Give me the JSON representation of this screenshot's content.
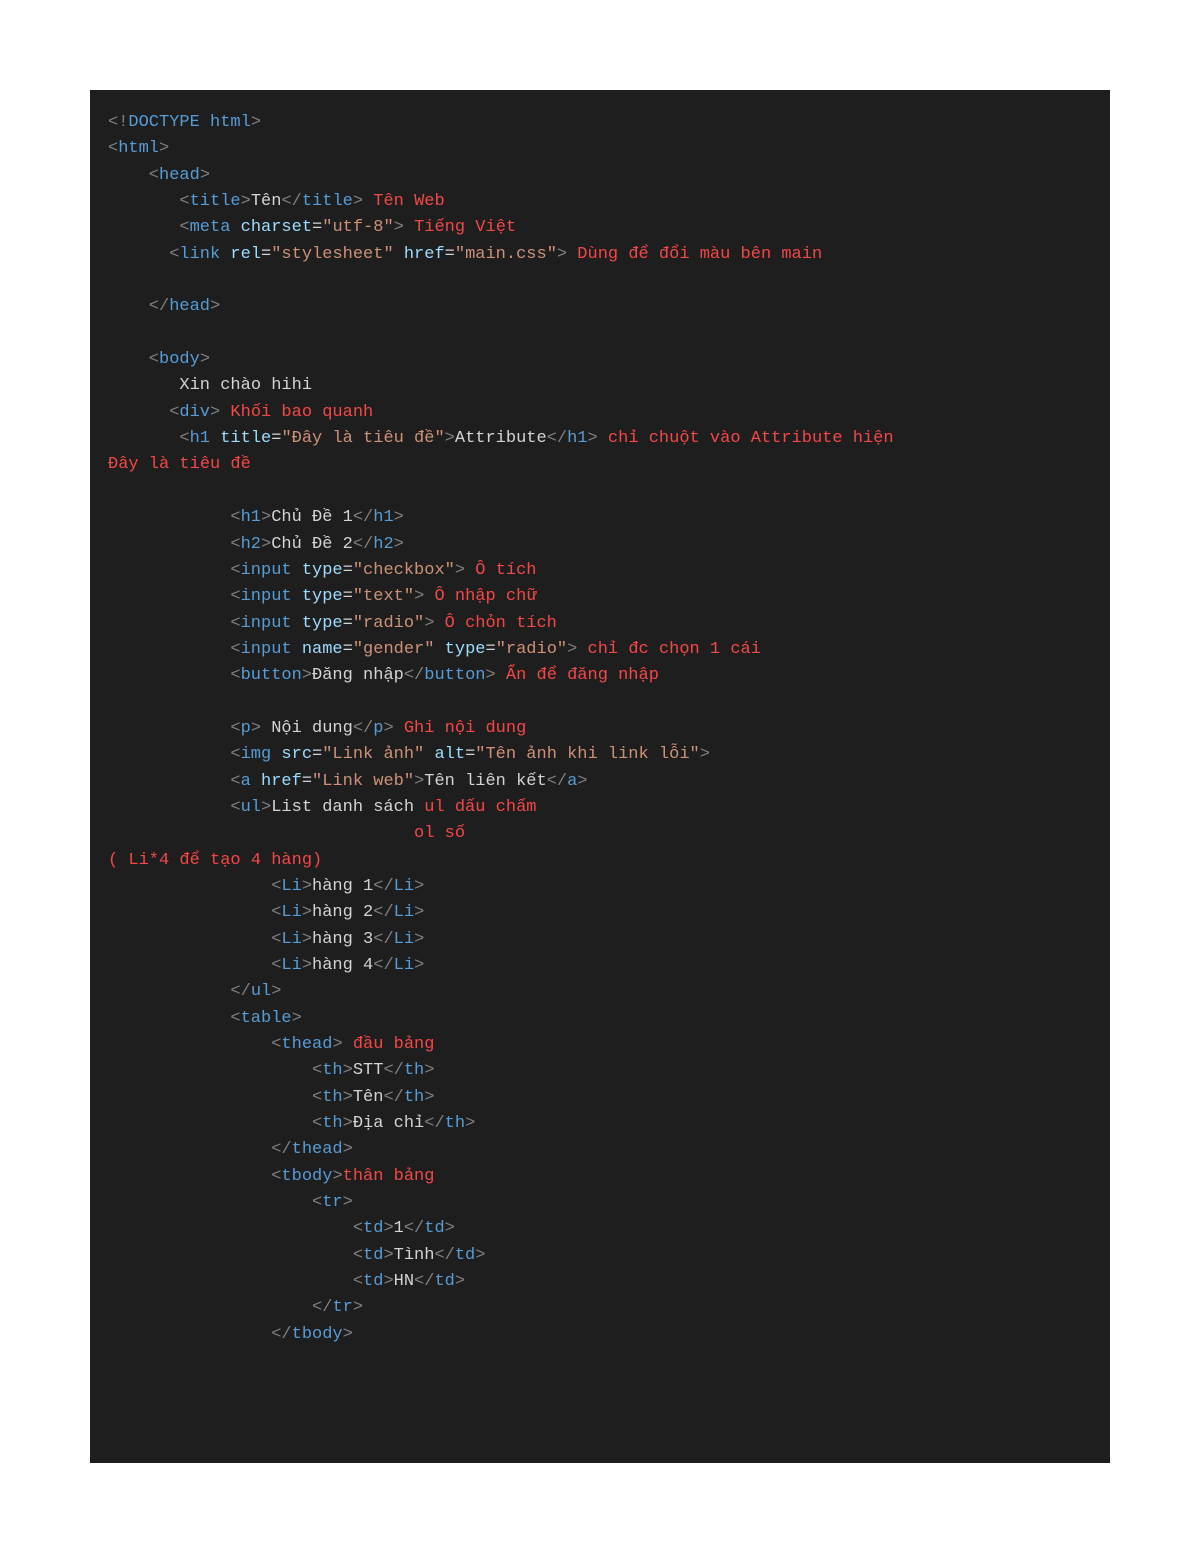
{
  "code": {
    "l1": {
      "p1": "<!",
      "p2": "DOCTYPE",
      "p3": " ",
      "p4": "html",
      "p5": ">"
    },
    "l2": {
      "p1": "<",
      "p2": "html",
      "p3": ">"
    },
    "l3": {
      "p1": "<",
      "p2": "head",
      "p3": ">"
    },
    "l4": {
      "p1": "<",
      "p2": "title",
      "p3": ">",
      "p4": "Tên",
      "p5": "</",
      "p6": "title",
      "p7": ">",
      "p8": " Tên Web"
    },
    "l5": {
      "p1": "<",
      "p2": "meta",
      "p3": " ",
      "p4": "charset",
      "p5": "=",
      "p6": "\"utf-8\"",
      "p7": ">",
      "p8": " Tiếng Việt"
    },
    "l6": {
      "p1": "<",
      "p2": "link",
      "p3": " ",
      "p4": "rel",
      "p5": "=",
      "p6": "\"stylesheet\"",
      "p7": " ",
      "p8": "href",
      "p9": "=",
      "p10": "\"main.css\"",
      "p11": ">",
      "p12": " Dùng để đổi màu bên main"
    },
    "l7": {
      "p1": "</",
      "p2": "head",
      "p3": ">"
    },
    "l8": {
      "p1": "<",
      "p2": "body",
      "p3": ">"
    },
    "l9": {
      "p1": "Xin chào hihi"
    },
    "l10": {
      "p1": "<",
      "p2": "div",
      "p3": ">",
      "p4": " Khối bao quanh"
    },
    "l11": {
      "p1": "<",
      "p2": "h1",
      "p3": " ",
      "p4": "title",
      "p5": "=",
      "p6": "\"Đây là tiêu đề\"",
      "p7": ">",
      "p8": "Attribute",
      "p9": "</",
      "p10": "h1",
      "p11": ">",
      "p12": " chỉ chuột vào Attribute hiện"
    },
    "l12": {
      "p1": "Đây là tiêu đề"
    },
    "l13": {
      "p1": "<",
      "p2": "h1",
      "p3": ">",
      "p4": "Chủ Đề 1",
      "p5": "</",
      "p6": "h1",
      "p7": ">"
    },
    "l14": {
      "p1": "<",
      "p2": "h2",
      "p3": ">",
      "p4": "Chủ Đề 2",
      "p5": "</",
      "p6": "h2",
      "p7": ">"
    },
    "l15": {
      "p1": "<",
      "p2": "input",
      "p3": " ",
      "p4": "type",
      "p5": "=",
      "p6": "\"checkbox\"",
      "p7": ">",
      "p8": " Ô tích"
    },
    "l16": {
      "p1": "<",
      "p2": "input",
      "p3": " ",
      "p4": "type",
      "p5": "=",
      "p6": "\"text\"",
      "p7": ">",
      "p8": " Ô nhập chữ"
    },
    "l17": {
      "p1": "<",
      "p2": "input",
      "p3": " ",
      "p4": "type",
      "p5": "=",
      "p6": "\"radio\"",
      "p7": ">",
      "p8": " Ô chỏn tích"
    },
    "l18": {
      "p1": "<",
      "p2": "input",
      "p3": " ",
      "p4": "name",
      "p5": "=",
      "p6": "\"gender\"",
      "p7": " ",
      "p8": "type",
      "p9": "=",
      "p10": "\"radio\"",
      "p11": ">",
      "p12": " chỉ đc chọn 1 cái"
    },
    "l19": {
      "p1": "<",
      "p2": "button",
      "p3": ">",
      "p4": "Đăng nhập",
      "p5": "</",
      "p6": "button",
      "p7": ">",
      "p8": " Ẩn để đăng nhập"
    },
    "l20": {
      "p1": "<",
      "p2": "p",
      "p3": ">",
      "p4": " Nội dung",
      "p5": "</",
      "p6": "p",
      "p7": ">",
      "p8": " Ghi nội dung"
    },
    "l21": {
      "p1": "<",
      "p2": "img",
      "p3": " ",
      "p4": "src",
      "p5": "=",
      "p6": "\"Link ảnh\"",
      "p7": " ",
      "p8": "alt",
      "p9": "=",
      "p10": "\"Tên ảnh khi link lỗi\"",
      "p11": ">"
    },
    "l22": {
      "p1": "<",
      "p2": "a",
      "p3": " ",
      "p4": "href",
      "p5": "=",
      "p6": "\"Link web\"",
      "p7": ">",
      "p8": "Tên liên kết",
      "p9": "</",
      "p10": "a",
      "p11": ">"
    },
    "l23": {
      "p1": "<",
      "p2": "ul",
      "p3": ">",
      "p4": "List danh sách ",
      "p5": "ul dấu chấm"
    },
    "l24": {
      "p1": "ol số"
    },
    "l25": {
      "p1": "( Li*4 để tạo 4 hàng)"
    },
    "l26": {
      "p1": "<",
      "p2": "Li",
      "p3": ">",
      "p4": "hàng 1",
      "p5": "</",
      "p6": "Li",
      "p7": ">"
    },
    "l27": {
      "p1": "<",
      "p2": "Li",
      "p3": ">",
      "p4": "hàng 2",
      "p5": "</",
      "p6": "Li",
      "p7": ">"
    },
    "l28": {
      "p1": "<",
      "p2": "Li",
      "p3": ">",
      "p4": "hàng 3",
      "p5": "</",
      "p6": "Li",
      "p7": ">"
    },
    "l29": {
      "p1": "<",
      "p2": "Li",
      "p3": ">",
      "p4": "hàng 4",
      "p5": "</",
      "p6": "Li",
      "p7": ">"
    },
    "l30": {
      "p1": "</",
      "p2": "ul",
      "p3": ">"
    },
    "l31": {
      "p1": "<",
      "p2": "table",
      "p3": ">"
    },
    "l32": {
      "p1": "<",
      "p2": "thead",
      "p3": ">",
      "p4": " đầu bảng"
    },
    "l33": {
      "p1": "<",
      "p2": "th",
      "p3": ">",
      "p4": "STT",
      "p5": "</",
      "p6": "th",
      "p7": ">"
    },
    "l34": {
      "p1": "<",
      "p2": "th",
      "p3": ">",
      "p4": "Tên",
      "p5": "</",
      "p6": "th",
      "p7": ">"
    },
    "l35": {
      "p1": "<",
      "p2": "th",
      "p3": ">",
      "p4": "Địa chỉ",
      "p5": "</",
      "p6": "th",
      "p7": ">"
    },
    "l36": {
      "p1": "</",
      "p2": "thead",
      "p3": ">"
    },
    "l37": {
      "p1": "<",
      "p2": "tbody",
      "p3": ">",
      "p4": "thân bảng"
    },
    "l38": {
      "p1": "<",
      "p2": "tr",
      "p3": ">"
    },
    "l39": {
      "p1": "<",
      "p2": "td",
      "p3": ">",
      "p4": "1",
      "p5": "</",
      "p6": "td",
      "p7": ">"
    },
    "l40": {
      "p1": "<",
      "p2": "td",
      "p3": ">",
      "p4": "Tình",
      "p5": "</",
      "p6": "td",
      "p7": ">"
    },
    "l41": {
      "p1": "<",
      "p2": "td",
      "p3": ">",
      "p4": "HN",
      "p5": "</",
      "p6": "td",
      "p7": ">"
    },
    "l42": {
      "p1": "</",
      "p2": "tr",
      "p3": ">"
    },
    "l43": {
      "p1": "</",
      "p2": "tbody",
      "p3": ">"
    }
  }
}
